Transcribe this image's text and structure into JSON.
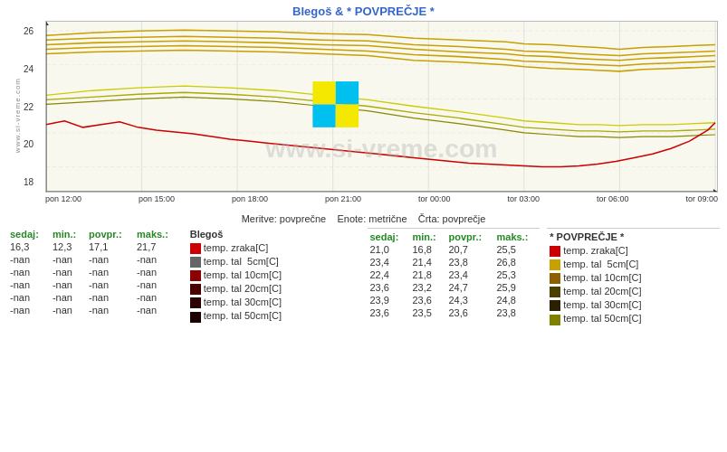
{
  "title": "Blegoš & * POVPREČJE *",
  "chart": {
    "y_labels": [
      "26",
      "24",
      "22",
      "20",
      "18"
    ],
    "x_labels": [
      "pon 12:00",
      "pon 15:00",
      "pon 18:00",
      "pon 21:00",
      "tor 00:00",
      "tor 03:00",
      "tor 06:00",
      "tor 09:00"
    ],
    "watermark": "www.si-vreme.com",
    "si_vreme_side": "www.si-vreme.com"
  },
  "info": {
    "meritve": "Meritve: povprečne",
    "enote": "Enote: metrične",
    "crta": "Črta: povprečje"
  },
  "table1": {
    "headers": [
      "sedaj:",
      "min.:",
      "povpr.:",
      "maks.:"
    ],
    "rows": [
      [
        "16,3",
        "12,3",
        "17,1",
        "21,7"
      ],
      [
        "-nan",
        "-nan",
        "-nan",
        "-nan"
      ],
      [
        "-nan",
        "-nan",
        "-nan",
        "-nan"
      ],
      [
        "-nan",
        "-nan",
        "-nan",
        "-nan"
      ],
      [
        "-nan",
        "-nan",
        "-nan",
        "-nan"
      ],
      [
        "-nan",
        "-nan",
        "-nan",
        "-nan"
      ]
    ]
  },
  "table2": {
    "title": "Blegoš",
    "rows": [
      {
        "color": "#cc0000",
        "label": "temp. zraka[C]"
      },
      {
        "color": "#555555",
        "label": "temp. tal  5cm[C]"
      },
      {
        "color": "#8B0000",
        "label": "temp. tal 10cm[C]"
      },
      {
        "color": "#4B0000",
        "label": "temp. tal 20cm[C]"
      },
      {
        "color": "#2B0000",
        "label": "temp. tal 30cm[C]"
      },
      {
        "color": "#1a0000",
        "label": "temp. tal 50cm[C]"
      }
    ]
  },
  "table3": {
    "headers": [
      "sedaj:",
      "min.:",
      "povpr.:",
      "maks.:"
    ],
    "rows": [
      [
        "21,0",
        "16,8",
        "20,7",
        "25,5"
      ],
      [
        "23,4",
        "21,4",
        "23,8",
        "26,8"
      ],
      [
        "22,4",
        "21,8",
        "23,4",
        "25,3"
      ],
      [
        "23,6",
        "23,2",
        "24,7",
        "25,9"
      ],
      [
        "23,9",
        "23,6",
        "24,3",
        "24,8"
      ],
      [
        "23,6",
        "23,5",
        "23,6",
        "23,8"
      ]
    ]
  },
  "table4": {
    "title": "* POVPREČJE *",
    "rows": [
      {
        "color": "#cc0000",
        "label": "temp. zraka[C]"
      },
      {
        "color": "#c8a000",
        "label": "temp. tal  5cm[C]"
      },
      {
        "color": "#8B6000",
        "label": "temp. tal 10cm[C]"
      },
      {
        "color": "#4B4000",
        "label": "temp. tal 20cm[C]"
      },
      {
        "color": "#2B2000",
        "label": "temp. tal 30cm[C]"
      },
      {
        "color": "#808000",
        "label": "temp. tal 50cm[C]"
      }
    ]
  },
  "logo": {
    "yellow": "#f5e800",
    "cyan": "#00c0f0"
  }
}
